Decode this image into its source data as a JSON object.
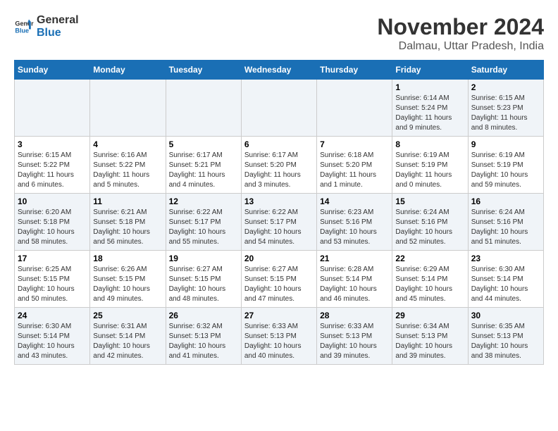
{
  "logo": {
    "line1": "General",
    "line2": "Blue"
  },
  "title": "November 2024",
  "subtitle": "Dalmau, Uttar Pradesh, India",
  "weekdays": [
    "Sunday",
    "Monday",
    "Tuesday",
    "Wednesday",
    "Thursday",
    "Friday",
    "Saturday"
  ],
  "weeks": [
    [
      {
        "day": "",
        "info": ""
      },
      {
        "day": "",
        "info": ""
      },
      {
        "day": "",
        "info": ""
      },
      {
        "day": "",
        "info": ""
      },
      {
        "day": "",
        "info": ""
      },
      {
        "day": "1",
        "info": "Sunrise: 6:14 AM\nSunset: 5:24 PM\nDaylight: 11 hours and 9 minutes."
      },
      {
        "day": "2",
        "info": "Sunrise: 6:15 AM\nSunset: 5:23 PM\nDaylight: 11 hours and 8 minutes."
      }
    ],
    [
      {
        "day": "3",
        "info": "Sunrise: 6:15 AM\nSunset: 5:22 PM\nDaylight: 11 hours and 6 minutes."
      },
      {
        "day": "4",
        "info": "Sunrise: 6:16 AM\nSunset: 5:22 PM\nDaylight: 11 hours and 5 minutes."
      },
      {
        "day": "5",
        "info": "Sunrise: 6:17 AM\nSunset: 5:21 PM\nDaylight: 11 hours and 4 minutes."
      },
      {
        "day": "6",
        "info": "Sunrise: 6:17 AM\nSunset: 5:20 PM\nDaylight: 11 hours and 3 minutes."
      },
      {
        "day": "7",
        "info": "Sunrise: 6:18 AM\nSunset: 5:20 PM\nDaylight: 11 hours and 1 minute."
      },
      {
        "day": "8",
        "info": "Sunrise: 6:19 AM\nSunset: 5:19 PM\nDaylight: 11 hours and 0 minutes."
      },
      {
        "day": "9",
        "info": "Sunrise: 6:19 AM\nSunset: 5:19 PM\nDaylight: 10 hours and 59 minutes."
      }
    ],
    [
      {
        "day": "10",
        "info": "Sunrise: 6:20 AM\nSunset: 5:18 PM\nDaylight: 10 hours and 58 minutes."
      },
      {
        "day": "11",
        "info": "Sunrise: 6:21 AM\nSunset: 5:18 PM\nDaylight: 10 hours and 56 minutes."
      },
      {
        "day": "12",
        "info": "Sunrise: 6:22 AM\nSunset: 5:17 PM\nDaylight: 10 hours and 55 minutes."
      },
      {
        "day": "13",
        "info": "Sunrise: 6:22 AM\nSunset: 5:17 PM\nDaylight: 10 hours and 54 minutes."
      },
      {
        "day": "14",
        "info": "Sunrise: 6:23 AM\nSunset: 5:16 PM\nDaylight: 10 hours and 53 minutes."
      },
      {
        "day": "15",
        "info": "Sunrise: 6:24 AM\nSunset: 5:16 PM\nDaylight: 10 hours and 52 minutes."
      },
      {
        "day": "16",
        "info": "Sunrise: 6:24 AM\nSunset: 5:16 PM\nDaylight: 10 hours and 51 minutes."
      }
    ],
    [
      {
        "day": "17",
        "info": "Sunrise: 6:25 AM\nSunset: 5:15 PM\nDaylight: 10 hours and 50 minutes."
      },
      {
        "day": "18",
        "info": "Sunrise: 6:26 AM\nSunset: 5:15 PM\nDaylight: 10 hours and 49 minutes."
      },
      {
        "day": "19",
        "info": "Sunrise: 6:27 AM\nSunset: 5:15 PM\nDaylight: 10 hours and 48 minutes."
      },
      {
        "day": "20",
        "info": "Sunrise: 6:27 AM\nSunset: 5:15 PM\nDaylight: 10 hours and 47 minutes."
      },
      {
        "day": "21",
        "info": "Sunrise: 6:28 AM\nSunset: 5:14 PM\nDaylight: 10 hours and 46 minutes."
      },
      {
        "day": "22",
        "info": "Sunrise: 6:29 AM\nSunset: 5:14 PM\nDaylight: 10 hours and 45 minutes."
      },
      {
        "day": "23",
        "info": "Sunrise: 6:30 AM\nSunset: 5:14 PM\nDaylight: 10 hours and 44 minutes."
      }
    ],
    [
      {
        "day": "24",
        "info": "Sunrise: 6:30 AM\nSunset: 5:14 PM\nDaylight: 10 hours and 43 minutes."
      },
      {
        "day": "25",
        "info": "Sunrise: 6:31 AM\nSunset: 5:14 PM\nDaylight: 10 hours and 42 minutes."
      },
      {
        "day": "26",
        "info": "Sunrise: 6:32 AM\nSunset: 5:13 PM\nDaylight: 10 hours and 41 minutes."
      },
      {
        "day": "27",
        "info": "Sunrise: 6:33 AM\nSunset: 5:13 PM\nDaylight: 10 hours and 40 minutes."
      },
      {
        "day": "28",
        "info": "Sunrise: 6:33 AM\nSunset: 5:13 PM\nDaylight: 10 hours and 39 minutes."
      },
      {
        "day": "29",
        "info": "Sunrise: 6:34 AM\nSunset: 5:13 PM\nDaylight: 10 hours and 39 minutes."
      },
      {
        "day": "30",
        "info": "Sunrise: 6:35 AM\nSunset: 5:13 PM\nDaylight: 10 hours and 38 minutes."
      }
    ]
  ],
  "colors": {
    "header_bg": "#1a6fb5",
    "row_shaded": "#f0f4f8",
    "row_white": "#ffffff"
  }
}
